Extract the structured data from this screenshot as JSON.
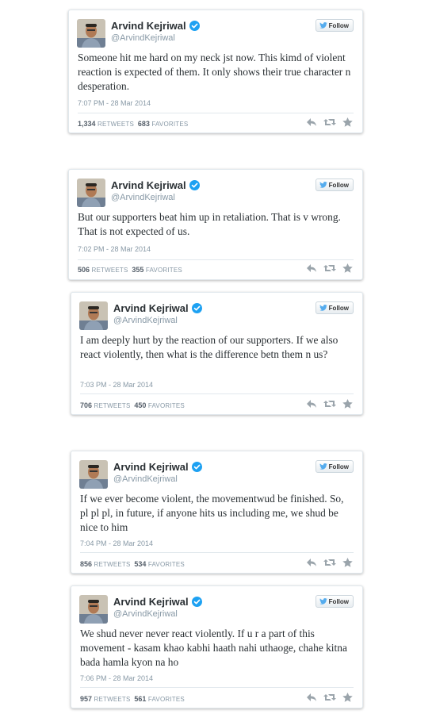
{
  "author": {
    "name": "Arvind Kejriwal",
    "handle": "@ArvindKejriwal"
  },
  "follow_label": "Follow",
  "stat_labels": {
    "retweets": "RETWEETS",
    "favorites": "FAVORITES"
  },
  "colors": {
    "verified": "#1da1f2",
    "follow_bird": "#55acee",
    "action_icons": "#9aa4ab"
  },
  "icons": [
    "verified-badge-icon",
    "twitter-bird-icon",
    "reply-icon",
    "retweet-icon",
    "favorite-star-icon"
  ],
  "tweets": [
    {
      "text": "Someone hit me hard on my neck jst now. This kimd of violent reaction is expected of them. It only shows their true character n desperation.",
      "timestamp": "7:07 PM - 28 Mar 2014",
      "retweets": "1,334",
      "favorites": "683"
    },
    {
      "text": "But our supporters beat him up in retaliation. That is v wrong. That is not expected of us.",
      "timestamp": "7:02 PM - 28 Mar 2014",
      "retweets": "506",
      "favorites": "355"
    },
    {
      "text": "I am deeply hurt by the reaction of our supporters. If we also react violently, then what is the difference betn them n us?",
      "timestamp": "7:03 PM - 28 Mar 2014",
      "retweets": "706",
      "favorites": "450"
    },
    {
      "text": "If we ever become violent, the movementwud be finished. So, pl pl pl, in future, if anyone hits us including me, we shud be nice to him",
      "timestamp": "7:04 PM - 28 Mar 2014",
      "retweets": "856",
      "favorites": "534"
    },
    {
      "text": "We shud never never react violently. If u r a part of this movement - kasam khao kabhi haath nahi uthaoge, chahe kitna bada hamla kyon na ho",
      "timestamp": "7:06 PM - 28 Mar 2014",
      "retweets": "957",
      "favorites": "561"
    }
  ]
}
